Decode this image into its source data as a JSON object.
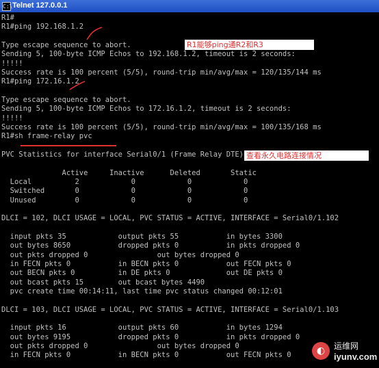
{
  "window": {
    "title": "Telnet 127.0.0.1",
    "icon": "cmd-icon",
    "background": "#000000",
    "text_color": "#c0c0c0",
    "annotation_color": "#e03030"
  },
  "console_lines": [
    "R1#",
    "R1#ping 192.168.1.2",
    "",
    "Type escape sequence to abort.",
    "Sending 5, 100-byte ICMP Echos to 192.168.1.2, timeout is 2 seconds:",
    "!!!!!",
    "Success rate is 100 percent (5/5), round-trip min/avg/max = 120/135/144 ms",
    "R1#ping 172.16.1.2",
    "",
    "Type escape sequence to abort.",
    "Sending 5, 100-byte ICMP Echos to 172.16.1.2, timeout is 2 seconds:",
    "!!!!!",
    "Success rate is 100 percent (5/5), round-trip min/avg/max = 100/135/168 ms",
    "R1#sh frame-relay pvc",
    "",
    "PVC Statistics for interface Serial0/1 (Frame Relay DTE)",
    "",
    "              Active     Inactive      Deleted       Static",
    "  Local          2            0            0            0",
    "  Switched       0            0            0            0",
    "  Unused         0            0            0            0",
    "",
    "DLCI = 102, DLCI USAGE = LOCAL, PVC STATUS = ACTIVE, INTERFACE = Serial0/1.102",
    "",
    "  input pkts 35            output pkts 55           in bytes 3300",
    "  out bytes 8650           dropped pkts 0           in pkts dropped 0",
    "  out pkts dropped 0                out bytes dropped 0",
    "  in FECN pkts 0           in BECN pkts 0           out FECN pkts 0",
    "  out BECN pkts 0          in DE pkts 0             out DE pkts 0",
    "  out bcast pkts 15        out bcast bytes 4490",
    "  pvc create time 00:14:11, last time pvc status changed 00:12:01",
    "",
    "DLCI = 103, DLCI USAGE = LOCAL, PVC STATUS = ACTIVE, INTERFACE = Serial0/1.103",
    "",
    "  input pkts 16            output pkts 60           in bytes 1294",
    "  out bytes 9195           dropped pkts 0           in pkts dropped 0",
    "  out pkts dropped 0                out bytes dropped 0",
    "  in FECN pkts 0           in BECN pkts 0           out FECN pkts 0"
  ],
  "annotations": {
    "ping_note": "R1能够ping通R2和R3",
    "pvc_note": "查看永久电路连接情况"
  },
  "watermark": {
    "line1": "运维网",
    "line2": "iyunv.com",
    "logo": "iyunv-logo-icon"
  }
}
